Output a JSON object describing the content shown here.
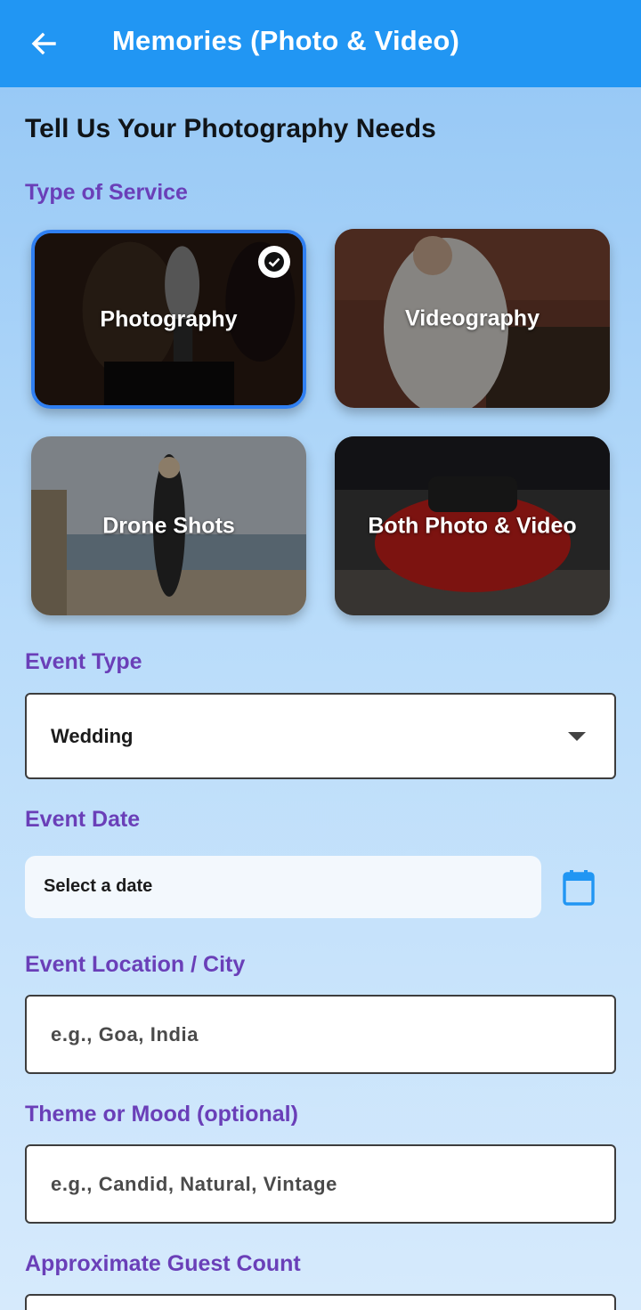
{
  "appbar": {
    "title": "Memories (Photo & Video)",
    "back_icon": "arrow-left-icon"
  },
  "page": {
    "heading": "Tell Us Your Photography Needs"
  },
  "service": {
    "label": "Type of Service",
    "selected": "Photography",
    "options": [
      {
        "label": "Photography",
        "selected": true
      },
      {
        "label": "Videography",
        "selected": false
      },
      {
        "label": "Drone Shots",
        "selected": false
      },
      {
        "label": "Both Photo & Video",
        "selected": false
      }
    ]
  },
  "event_type": {
    "label": "Event Type",
    "value": "Wedding"
  },
  "event_date": {
    "label": "Event Date",
    "value": "Select a date",
    "icon": "calendar-icon"
  },
  "location": {
    "label": "Event Location / City",
    "placeholder": "e.g., Goa, India"
  },
  "theme": {
    "label": "Theme or Mood (optional)",
    "placeholder": "e.g., Candid, Natural, Vintage"
  },
  "guests": {
    "label": "Approximate Guest Count"
  },
  "colors": {
    "appbar": "#2196f3",
    "label": "#6a3fb8",
    "selected_border": "#2f7ff2"
  }
}
